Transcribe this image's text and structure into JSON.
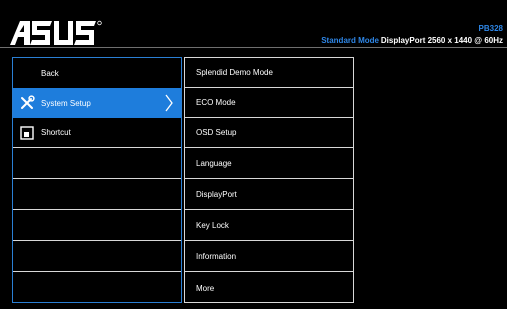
{
  "header": {
    "logo_text": "ASUS",
    "model": "PB328",
    "mode": "Standard Mode",
    "resolution": "DisplayPort 2560 x 1440 @ 60Hz"
  },
  "left_menu": {
    "items": [
      {
        "label": "Back",
        "icon": "none"
      },
      {
        "label": "System Setup",
        "icon": "wrench-screwdriver-icon",
        "selected": true,
        "arrow": "chevron-right-icon"
      },
      {
        "label": "Shortcut",
        "icon": "shortcut-icon"
      },
      {
        "label": ""
      },
      {
        "label": ""
      },
      {
        "label": ""
      },
      {
        "label": ""
      },
      {
        "label": ""
      }
    ]
  },
  "submenu": {
    "items": [
      {
        "label": "Splendid Demo Mode"
      },
      {
        "label": "ECO Mode"
      },
      {
        "label": "OSD Setup"
      },
      {
        "label": "Language"
      },
      {
        "label": "DisplayPort"
      },
      {
        "label": "Key Lock"
      },
      {
        "label": "Information"
      },
      {
        "label": "More"
      }
    ]
  },
  "colors": {
    "background": "#000000",
    "accent": "#1e7ddc",
    "header_text": "#2e86e6",
    "border": "#d8d8d8"
  }
}
